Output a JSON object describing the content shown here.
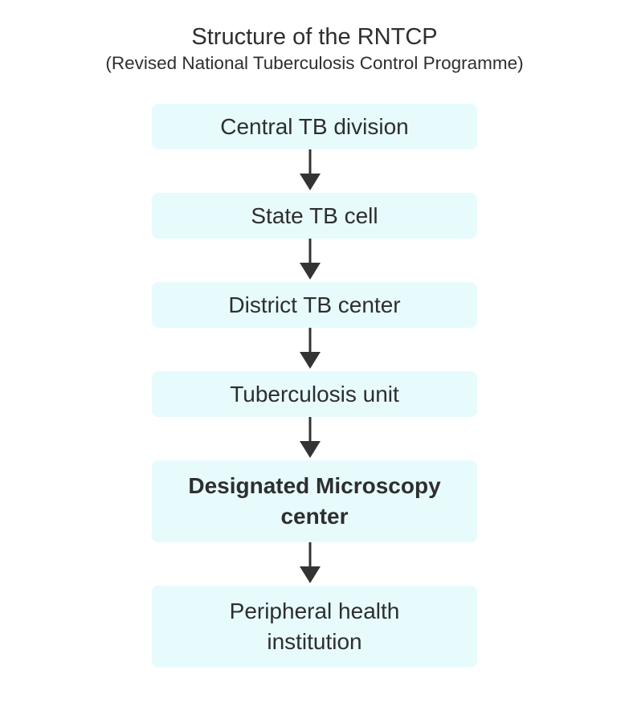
{
  "title": "Structure of the RNTCP",
  "subtitle": "(Revised National Tuberculosis Control Programme)",
  "nodes": [
    {
      "label": "Central TB division",
      "emphasis": false
    },
    {
      "label": "State TB cell",
      "emphasis": false
    },
    {
      "label": "District TB center",
      "emphasis": false
    },
    {
      "label": "Tuberculosis unit",
      "emphasis": false
    },
    {
      "label": "Designated Microscopy center",
      "emphasis": true
    },
    {
      "label": "Peripheral health institution",
      "emphasis": false
    }
  ],
  "colors": {
    "box_fill": "#e7fbfd",
    "text": "#2e2e2e",
    "arrow": "#333333"
  }
}
